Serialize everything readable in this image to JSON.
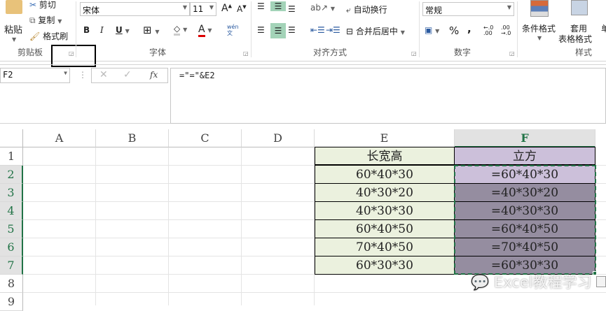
{
  "ribbon": {
    "clipboard": {
      "paste": "粘贴",
      "cut": "剪切",
      "copy": "复制",
      "format_painter": "格式刷",
      "group": "剪贴板"
    },
    "font": {
      "name": "宋体",
      "size": "11",
      "bold": "B",
      "italic": "I",
      "underline": "U",
      "phonetic": "wén\n文",
      "group": "字体"
    },
    "alignment": {
      "wrap": "自动换行",
      "merge": "合并后居中",
      "group": "对齐方式"
    },
    "number": {
      "format": "常规",
      "percent": "%",
      "comma": ",",
      "inc_dec": "←.0 .00",
      "dec_dec": ".00 →.0",
      "group": "数字"
    },
    "styles": {
      "conditional": "条件格式",
      "table_line1": "套用",
      "table_line2": "表格格式",
      "group": "样式",
      "cell_partial": "单"
    }
  },
  "formula_bar": {
    "name_box": "F2",
    "fx": "fx",
    "formula": "=\"=\"&E2"
  },
  "columns": [
    "A",
    "B",
    "C",
    "D",
    "E",
    "F"
  ],
  "rows": [
    "1",
    "2",
    "3",
    "4",
    "5",
    "6",
    "7",
    "8",
    "9"
  ],
  "table": {
    "headers": [
      "长宽高",
      "立方"
    ],
    "e_values": [
      "60*40*30",
      "40*30*20",
      "40*30*30",
      "60*40*50",
      "70*40*50",
      "60*30*30"
    ],
    "f_values": [
      "=60*40*30",
      "=40*30*20",
      "=40*30*30",
      "=60*40*50",
      "=70*40*50",
      "=60*30*30"
    ]
  },
  "watermark": "Excel教程学习",
  "colors": {
    "e_fill": "#ebf1de",
    "f_fill": "#ccc0da",
    "f_selected": "#958da0",
    "accent": "#217346"
  }
}
